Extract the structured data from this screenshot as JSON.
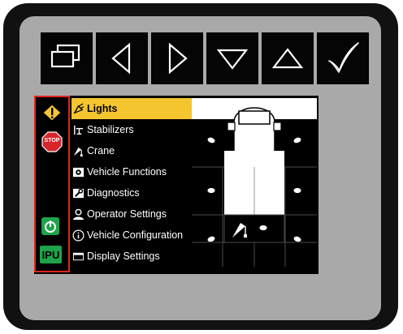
{
  "softkeys": [
    {
      "name": "windows-icon"
    },
    {
      "name": "arrow-left-icon"
    },
    {
      "name": "arrow-right-icon"
    },
    {
      "name": "arrow-down-icon"
    },
    {
      "name": "arrow-up-icon"
    },
    {
      "name": "checkmark-icon"
    }
  ],
  "alerts": {
    "warning": "warning-icon",
    "stop_label": "STOP",
    "power": "power-indicator-icon",
    "ipu_label": "IPU"
  },
  "menu": {
    "items": [
      {
        "label": "Lights",
        "icon": "lights-icon",
        "active": true
      },
      {
        "label": "Stabilizers",
        "icon": "stabilizers-icon"
      },
      {
        "label": "Crane",
        "icon": "crane-icon"
      },
      {
        "label": "Vehicle Functions",
        "icon": "vehicle-functions-icon"
      },
      {
        "label": "Diagnostics",
        "icon": "wrench-icon"
      },
      {
        "label": "Operator Settings",
        "icon": "operator-icon"
      },
      {
        "label": "Vehicle Configuration",
        "icon": "info-icon"
      },
      {
        "label": "Display Settings",
        "icon": "display-icon"
      }
    ]
  },
  "colors": {
    "accent": "#f4c52f",
    "alert_border": "#e0231b",
    "ipu_green": "#1ea34a",
    "warning_yellow": "#f4c52f",
    "stop_red": "#d7262b"
  }
}
